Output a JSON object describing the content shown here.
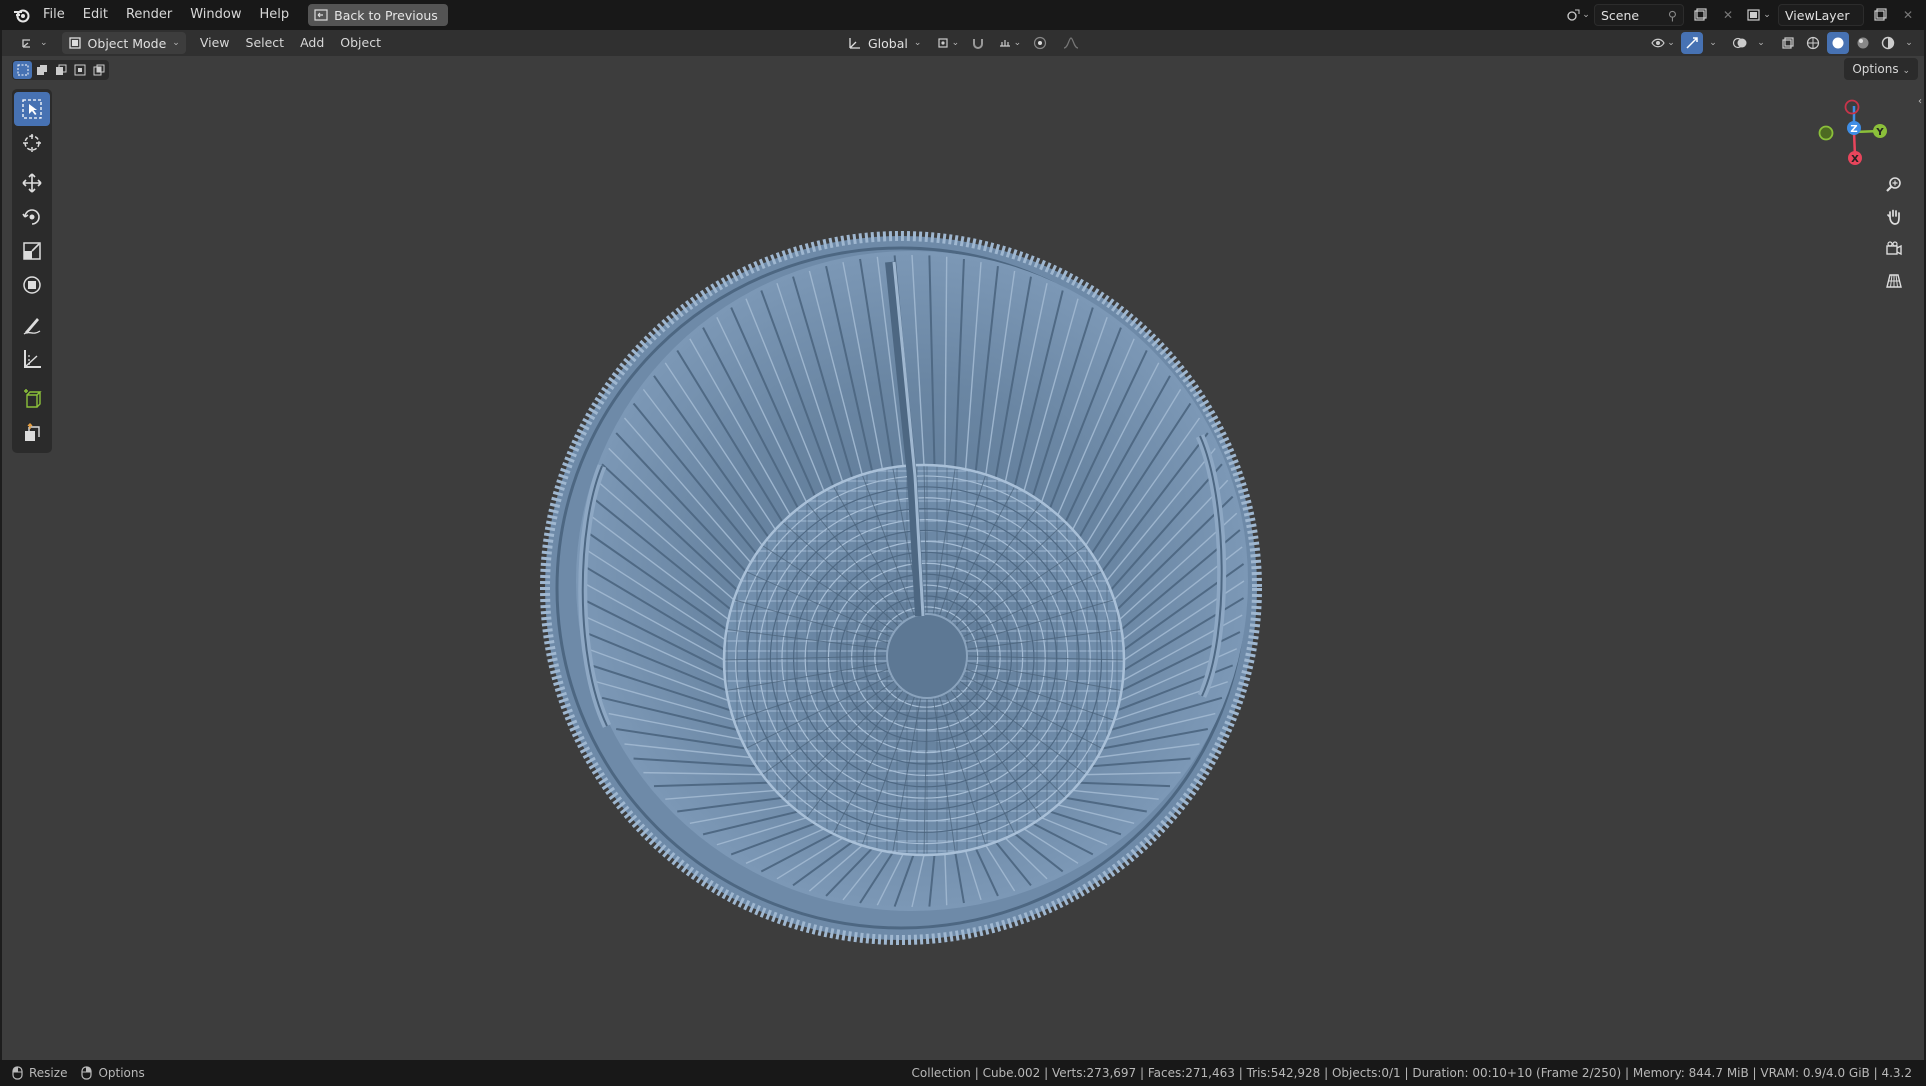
{
  "menu": {
    "items": [
      "File",
      "Edit",
      "Render",
      "Window",
      "Help"
    ],
    "back_button": "Back to Previous"
  },
  "topbar_right": {
    "scene": "Scene",
    "view_layer": "ViewLayer"
  },
  "header": {
    "mode": "Object Mode",
    "menus": [
      "View",
      "Select",
      "Add",
      "Object"
    ],
    "transform_orientation": "Global"
  },
  "viewport": {
    "options_label": "Options",
    "gizmo": {
      "x": "X",
      "y": "Y",
      "z": "Z"
    }
  },
  "toolbar": {
    "tools": [
      "select-box",
      "cursor",
      "move",
      "rotate",
      "scale",
      "transform",
      "annotate",
      "measure",
      "add-cube",
      "extrude"
    ],
    "active_tool": "select-box"
  },
  "statusbar": {
    "left": [
      {
        "icon": "mouse-icon",
        "label": "Resize"
      },
      {
        "icon": "mouse-icon",
        "label": "Options"
      }
    ],
    "info": "Collection | Cube.002 | Verts:273,697 | Faces:271,463 | Tris:542,928 | Objects:0/1 | Duration: 00:10+10 (Frame 2/250) | Memory: 844.7 MiB | VRAM: 0.9/4.0 GiB | 4.3.2"
  },
  "colors": {
    "accent": "#4772b3",
    "viewport_bg": "#3d3d3d",
    "model": "#7895b3",
    "axis_x": "#e8455c",
    "axis_y": "#8bc03a",
    "axis_z": "#3f8ee6"
  }
}
